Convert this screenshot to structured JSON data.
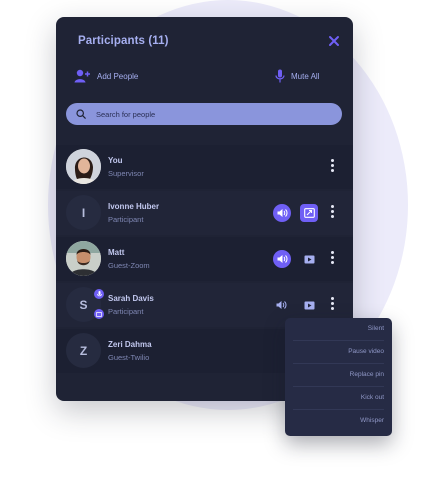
{
  "header": {
    "title": "Participants (11)"
  },
  "toolbar": {
    "add_people_label": "Add People",
    "mute_all_label": "Mute All"
  },
  "search": {
    "placeholder": "Search for people",
    "value": ""
  },
  "participants": [
    {
      "name": "You",
      "role": "Supervisor",
      "initial": "",
      "avatar": "photo-woman",
      "actions": []
    },
    {
      "name": "Ivonne Huber",
      "role": "Participant",
      "initial": "I",
      "avatar": "initial",
      "actions": [
        "volume-icon",
        "screen-share-icon"
      ]
    },
    {
      "name": "Matt",
      "role": "Guest-Zoom",
      "initial": "",
      "avatar": "photo-man",
      "actions": [
        "volume-icon",
        "video-icon"
      ]
    },
    {
      "name": "Sarah Davis",
      "role": "Participant",
      "initial": "S",
      "avatar": "initial",
      "actions": [
        "volume-icon",
        "video-icon"
      ]
    },
    {
      "name": "Zeri Dahma",
      "role": "Guest-Twilio",
      "initial": "Z",
      "avatar": "initial",
      "actions": []
    }
  ],
  "context_menu": {
    "items": [
      "Silent",
      "Pause video",
      "Replace pin",
      "Kick out",
      "Whisper"
    ]
  },
  "colors": {
    "panel_bg": "#1f2335",
    "accent": "#6f5ff5",
    "search_bg": "#8a95dc",
    "title_text": "#a6aff0"
  }
}
